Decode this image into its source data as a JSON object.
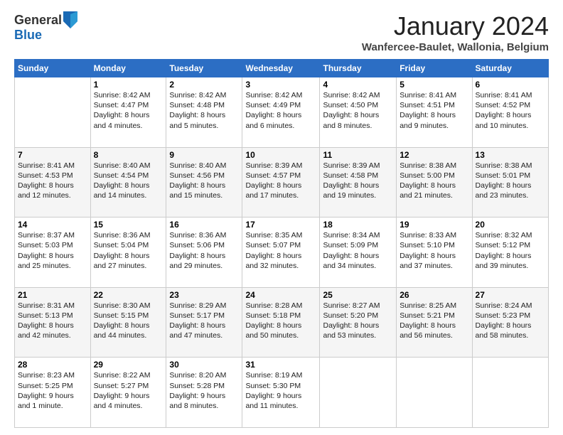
{
  "logo": {
    "general": "General",
    "blue": "Blue"
  },
  "header": {
    "month": "January 2024",
    "location": "Wanfercee-Baulet, Wallonia, Belgium"
  },
  "days": [
    "Sunday",
    "Monday",
    "Tuesday",
    "Wednesday",
    "Thursday",
    "Friday",
    "Saturday"
  ],
  "weeks": [
    [
      {
        "day": "",
        "content": ""
      },
      {
        "day": "1",
        "content": "Sunrise: 8:42 AM\nSunset: 4:47 PM\nDaylight: 8 hours\nand 4 minutes."
      },
      {
        "day": "2",
        "content": "Sunrise: 8:42 AM\nSunset: 4:48 PM\nDaylight: 8 hours\nand 5 minutes."
      },
      {
        "day": "3",
        "content": "Sunrise: 8:42 AM\nSunset: 4:49 PM\nDaylight: 8 hours\nand 6 minutes."
      },
      {
        "day": "4",
        "content": "Sunrise: 8:42 AM\nSunset: 4:50 PM\nDaylight: 8 hours\nand 8 minutes."
      },
      {
        "day": "5",
        "content": "Sunrise: 8:41 AM\nSunset: 4:51 PM\nDaylight: 8 hours\nand 9 minutes."
      },
      {
        "day": "6",
        "content": "Sunrise: 8:41 AM\nSunset: 4:52 PM\nDaylight: 8 hours\nand 10 minutes."
      }
    ],
    [
      {
        "day": "7",
        "content": "Sunrise: 8:41 AM\nSunset: 4:53 PM\nDaylight: 8 hours\nand 12 minutes."
      },
      {
        "day": "8",
        "content": "Sunrise: 8:40 AM\nSunset: 4:54 PM\nDaylight: 8 hours\nand 14 minutes."
      },
      {
        "day": "9",
        "content": "Sunrise: 8:40 AM\nSunset: 4:56 PM\nDaylight: 8 hours\nand 15 minutes."
      },
      {
        "day": "10",
        "content": "Sunrise: 8:39 AM\nSunset: 4:57 PM\nDaylight: 8 hours\nand 17 minutes."
      },
      {
        "day": "11",
        "content": "Sunrise: 8:39 AM\nSunset: 4:58 PM\nDaylight: 8 hours\nand 19 minutes."
      },
      {
        "day": "12",
        "content": "Sunrise: 8:38 AM\nSunset: 5:00 PM\nDaylight: 8 hours\nand 21 minutes."
      },
      {
        "day": "13",
        "content": "Sunrise: 8:38 AM\nSunset: 5:01 PM\nDaylight: 8 hours\nand 23 minutes."
      }
    ],
    [
      {
        "day": "14",
        "content": "Sunrise: 8:37 AM\nSunset: 5:03 PM\nDaylight: 8 hours\nand 25 minutes."
      },
      {
        "day": "15",
        "content": "Sunrise: 8:36 AM\nSunset: 5:04 PM\nDaylight: 8 hours\nand 27 minutes."
      },
      {
        "day": "16",
        "content": "Sunrise: 8:36 AM\nSunset: 5:06 PM\nDaylight: 8 hours\nand 29 minutes."
      },
      {
        "day": "17",
        "content": "Sunrise: 8:35 AM\nSunset: 5:07 PM\nDaylight: 8 hours\nand 32 minutes."
      },
      {
        "day": "18",
        "content": "Sunrise: 8:34 AM\nSunset: 5:09 PM\nDaylight: 8 hours\nand 34 minutes."
      },
      {
        "day": "19",
        "content": "Sunrise: 8:33 AM\nSunset: 5:10 PM\nDaylight: 8 hours\nand 37 minutes."
      },
      {
        "day": "20",
        "content": "Sunrise: 8:32 AM\nSunset: 5:12 PM\nDaylight: 8 hours\nand 39 minutes."
      }
    ],
    [
      {
        "day": "21",
        "content": "Sunrise: 8:31 AM\nSunset: 5:13 PM\nDaylight: 8 hours\nand 42 minutes."
      },
      {
        "day": "22",
        "content": "Sunrise: 8:30 AM\nSunset: 5:15 PM\nDaylight: 8 hours\nand 44 minutes."
      },
      {
        "day": "23",
        "content": "Sunrise: 8:29 AM\nSunset: 5:17 PM\nDaylight: 8 hours\nand 47 minutes."
      },
      {
        "day": "24",
        "content": "Sunrise: 8:28 AM\nSunset: 5:18 PM\nDaylight: 8 hours\nand 50 minutes."
      },
      {
        "day": "25",
        "content": "Sunrise: 8:27 AM\nSunset: 5:20 PM\nDaylight: 8 hours\nand 53 minutes."
      },
      {
        "day": "26",
        "content": "Sunrise: 8:25 AM\nSunset: 5:21 PM\nDaylight: 8 hours\nand 56 minutes."
      },
      {
        "day": "27",
        "content": "Sunrise: 8:24 AM\nSunset: 5:23 PM\nDaylight: 8 hours\nand 58 minutes."
      }
    ],
    [
      {
        "day": "28",
        "content": "Sunrise: 8:23 AM\nSunset: 5:25 PM\nDaylight: 9 hours\nand 1 minute."
      },
      {
        "day": "29",
        "content": "Sunrise: 8:22 AM\nSunset: 5:27 PM\nDaylight: 9 hours\nand 4 minutes."
      },
      {
        "day": "30",
        "content": "Sunrise: 8:20 AM\nSunset: 5:28 PM\nDaylight: 9 hours\nand 8 minutes."
      },
      {
        "day": "31",
        "content": "Sunrise: 8:19 AM\nSunset: 5:30 PM\nDaylight: 9 hours\nand 11 minutes."
      },
      {
        "day": "",
        "content": ""
      },
      {
        "day": "",
        "content": ""
      },
      {
        "day": "",
        "content": ""
      }
    ]
  ]
}
